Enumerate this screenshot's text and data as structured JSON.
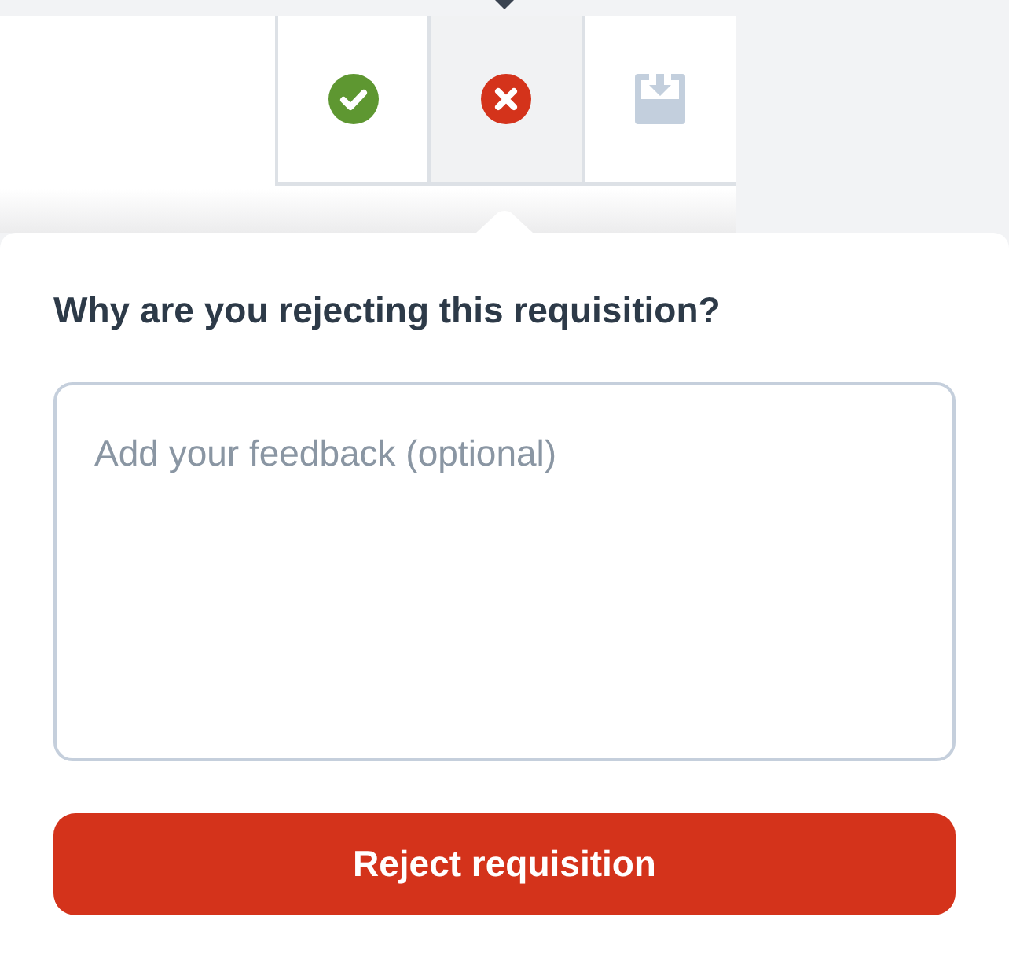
{
  "actions": [
    {
      "kind": "approve",
      "selected": false
    },
    {
      "kind": "reject",
      "selected": true
    },
    {
      "kind": "download",
      "selected": false
    }
  ],
  "popover": {
    "title": "Why are you rejecting this requisition?",
    "feedback": {
      "placeholder": "Add your feedback (optional)"
    },
    "submit_button": "Reject requisition"
  }
}
